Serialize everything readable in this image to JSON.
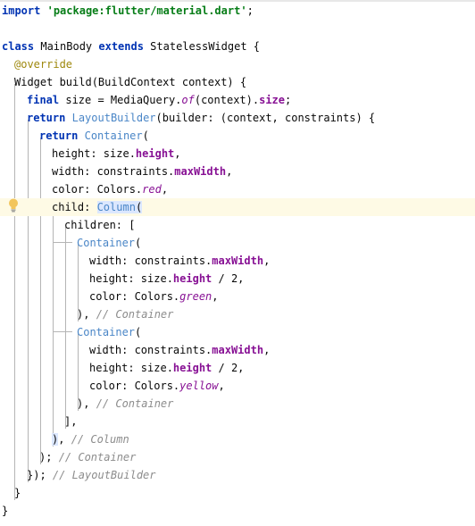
{
  "code": {
    "l1": {
      "kw": "import",
      "str": "'package:flutter/material.dart'",
      "tail": ";"
    },
    "l3": {
      "kw1": "class",
      "name": " MainBody ",
      "kw2": "extends",
      "rest": " StatelessWidget {"
    },
    "l4": {
      "ann": "@override"
    },
    "l5": {
      "text": "Widget build(BuildContext context) {"
    },
    "l6": {
      "kw": "final",
      "mid": " size = MediaQuery.",
      "italic": "of",
      "mid2": "(context).",
      "field": "size",
      "tail": ";"
    },
    "l7": {
      "kw": "return",
      "sp": " ",
      "type": "LayoutBuilder",
      "rest": "(builder: (context, constraints) {"
    },
    "l8": {
      "kw": "return",
      "sp": " ",
      "type": "Container",
      "rest": "("
    },
    "l9": {
      "pre": "height: size.",
      "field": "height",
      "tail": ","
    },
    "l10": {
      "pre": "width: constraints.",
      "field": "maxWidth",
      "tail": ","
    },
    "l11": {
      "pre": "color: Colors.",
      "italic": "red",
      "tail": ","
    },
    "l12": {
      "pre": "child: ",
      "type": "Column",
      "tail": "("
    },
    "l13": {
      "text": "children: ["
    },
    "l14": {
      "type": "Container",
      "tail": "("
    },
    "l15": {
      "pre": "width: constraints.",
      "field": "maxWidth",
      "tail": ","
    },
    "l16": {
      "pre": "height: size.",
      "field": "height",
      "tail": " / 2,"
    },
    "l17": {
      "pre": "color: Colors.",
      "italic": "green",
      "tail": ","
    },
    "l18": {
      "pre": "), ",
      "comment": "// Container"
    },
    "l19": {
      "type": "Container",
      "tail": "("
    },
    "l20": {
      "pre": "width: constraints.",
      "field": "maxWidth",
      "tail": ","
    },
    "l21": {
      "pre": "height: size.",
      "field": "height",
      "tail": " / 2,"
    },
    "l22": {
      "pre": "color: Colors.",
      "italic": "yellow",
      "tail": ","
    },
    "l23": {
      "pre": "), ",
      "comment": "// Container"
    },
    "l24": {
      "text": "],"
    },
    "l25": {
      "pre": ")",
      "mid": ", ",
      "comment": "// Column"
    },
    "l26": {
      "pre": "); ",
      "comment": "// Container"
    },
    "l27": {
      "pre": "}); ",
      "comment": "// LayoutBuilder"
    },
    "l28": {
      "text": "}"
    },
    "l29": {
      "text": "}"
    }
  },
  "icons": {
    "intention_bulb": "lightbulb-icon"
  },
  "colors": {
    "keyword": "#0033b3",
    "string": "#067d17",
    "annotation": "#9e880d",
    "type": "#4a86c7",
    "field": "#871094",
    "comment": "#8c8c8c",
    "current_line": "#fefae5",
    "bulb": "#f2c55c"
  }
}
